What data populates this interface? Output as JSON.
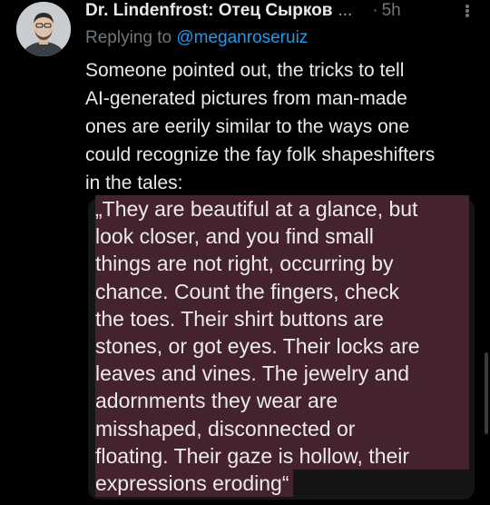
{
  "tweet": {
    "author_name": "Dr. Lindenfrost: Отец Сырков",
    "name_truncation": "...",
    "separator": "·",
    "time": "5h",
    "reply_prefix": "Replying to",
    "reply_handle": "@meganroseruiz",
    "body_lines": [
      "Someone pointed out, the tricks to tell",
      "AI-generated pictures from man-made",
      "ones are eerily similar to the ways one",
      "could recognize the fay folk shapeshifters",
      "in the tales:"
    ],
    "quote_lines": [
      "„They are beautiful at a glance, but",
      "look closer, and you find small",
      "things are not right, occurring by",
      "chance. Count the fingers, check",
      "the toes. Their shirt buttons are",
      "stones, or got eyes. Their locks are",
      "leaves and vines. The jewelry and",
      "adornments they wear are",
      "misshaped, disconnected or",
      "floating. Their gaze is hollow, their",
      "expressions eroding“"
    ]
  },
  "icons": {
    "avatar": "profile-photo",
    "more": "more-options-icon"
  },
  "colors": {
    "background": "#000000",
    "primary_text": "#e7e9ea",
    "secondary_text": "#71767b",
    "link": "#1d9bf0",
    "quote_highlight": "#45232e",
    "quote_card": "#141517"
  }
}
